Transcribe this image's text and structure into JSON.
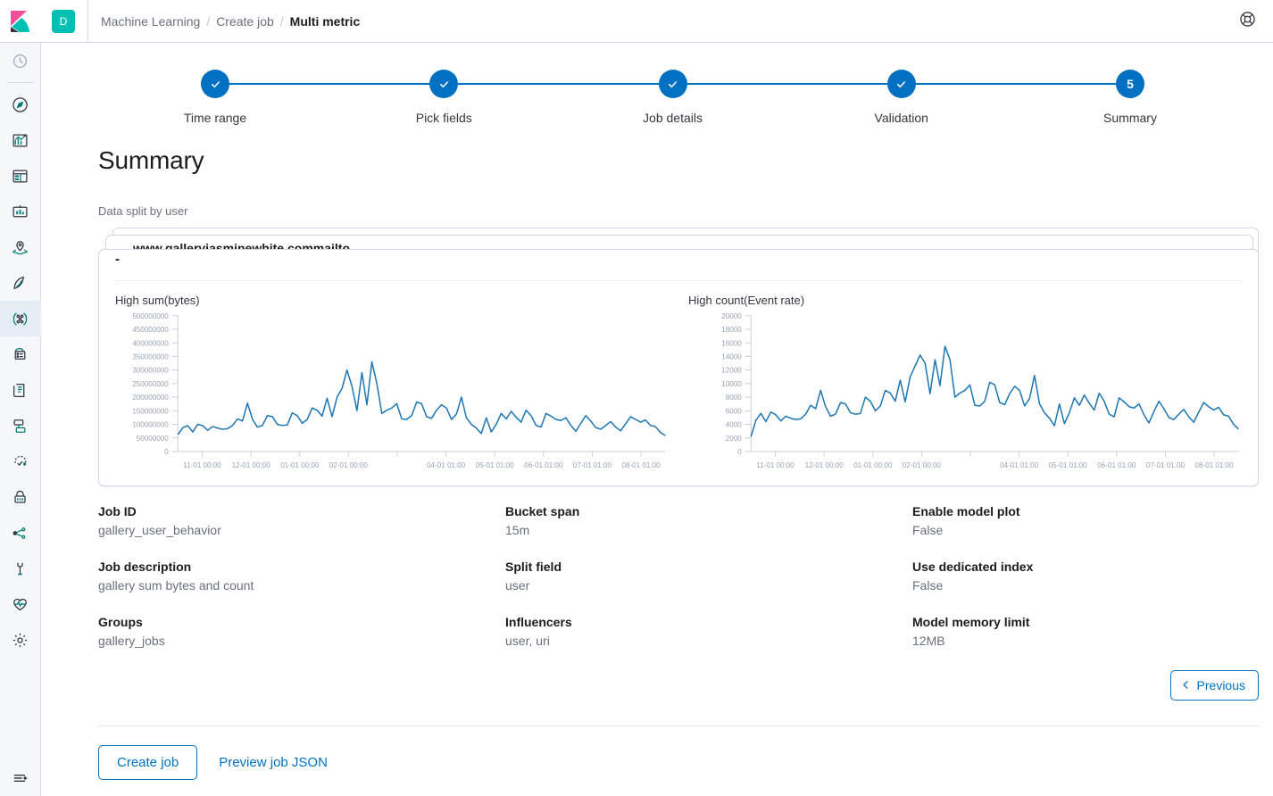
{
  "header": {
    "space_badge": "D",
    "breadcrumbs": [
      {
        "label": "Machine Learning",
        "current": false
      },
      {
        "label": "Create job",
        "current": false
      },
      {
        "label": "Multi metric",
        "current": true
      }
    ],
    "separator": "/",
    "help_icon": "help-lifebuoy-icon"
  },
  "sidebar": {
    "logo": "elastic-kibana-logo",
    "items": [
      {
        "icon": "recently-viewed-clock-icon",
        "selected": false
      },
      {
        "icon": "discover-compass-icon",
        "selected": false
      },
      {
        "icon": "visualize-chart-icon",
        "selected": false
      },
      {
        "icon": "dashboard-icon",
        "selected": false
      },
      {
        "icon": "canvas-icon",
        "selected": false
      },
      {
        "icon": "maps-icon",
        "selected": false
      },
      {
        "icon": "uptime-icon",
        "selected": false
      },
      {
        "icon": "machine-learning-icon",
        "selected": true
      },
      {
        "icon": "infrastructure-icon",
        "selected": false
      },
      {
        "icon": "logs-icon",
        "selected": false
      },
      {
        "icon": "apm-icon",
        "selected": false
      },
      {
        "icon": "siem-icon",
        "selected": false
      },
      {
        "icon": "security-lock-icon",
        "selected": false
      },
      {
        "icon": "graph-icon",
        "selected": false
      },
      {
        "icon": "dev-tools-wrench-icon",
        "selected": false
      },
      {
        "icon": "monitoring-heart-icon",
        "selected": false
      },
      {
        "icon": "management-gear-icon",
        "selected": false
      }
    ],
    "collapse_icon": "collapse-arrow-icon"
  },
  "steps": [
    {
      "num": "1",
      "label": "Time range",
      "complete": true
    },
    {
      "num": "2",
      "label": "Pick fields",
      "complete": true
    },
    {
      "num": "3",
      "label": "Job details",
      "complete": true
    },
    {
      "num": "4",
      "label": "Validation",
      "complete": true
    },
    {
      "num": "5",
      "label": "Summary",
      "complete": false
    }
  ],
  "page": {
    "title": "Summary",
    "split_label": "Data split by user"
  },
  "detector_cards": {
    "back_card_label": "....",
    "middle_card_label": "www.gallerviasminewhite.commailto",
    "front_card_label": "-"
  },
  "chart_data": [
    {
      "type": "line",
      "title": "High sum(bytes)",
      "xlabel": "",
      "ylabel": "",
      "ylim": [
        0,
        500000000
      ],
      "yticks": [
        0,
        50000000,
        100000000,
        150000000,
        200000000,
        250000000,
        300000000,
        350000000,
        400000000,
        450000000,
        500000000
      ],
      "ytick_labels": [
        "0",
        "50000000",
        "100000000",
        "150000000",
        "200000000",
        "250000000",
        "300000000",
        "350000000",
        "400000000",
        "450000000",
        "500000000"
      ],
      "xtick_labels": [
        "11-01 00:00",
        "12-01 00:00",
        "01-01 00:00",
        "02-01 00:00",
        "",
        "04-01 01:00",
        "05-01 01:00",
        "06-01 01:00",
        "07-01 01:00",
        "08-01 01:00"
      ],
      "grid": false,
      "legend": "none",
      "line_color": "#1f77b4",
      "values": [
        62,
        88,
        95,
        72,
        100,
        95,
        78,
        92,
        86,
        82,
        84,
        96,
        120,
        112,
        178,
        118,
        90,
        96,
        132,
        128,
        100,
        96,
        98,
        142,
        132,
        104,
        118,
        160,
        152,
        130,
        196,
        128,
        200,
        232,
        300,
        240,
        150,
        290,
        172,
        330,
        250,
        140,
        152,
        160,
        176,
        120,
        118,
        132,
        182,
        176,
        128,
        122,
        152,
        172,
        160,
        118,
        138,
        200,
        124,
        100,
        86,
        66,
        124,
        72,
        100,
        140,
        120,
        148,
        126,
        108,
        152,
        132,
        96,
        90,
        140,
        130,
        118,
        114,
        124,
        96,
        74,
        104,
        132,
        112,
        88,
        82,
        96,
        110,
        90,
        76,
        102,
        128,
        118,
        108,
        116,
        96,
        92,
        70,
        58
      ]
    },
    {
      "type": "line",
      "title": "High count(Event rate)",
      "xlabel": "",
      "ylabel": "",
      "ylim": [
        0,
        20000
      ],
      "yticks": [
        0,
        2000,
        4000,
        6000,
        8000,
        10000,
        12000,
        14000,
        16000,
        18000,
        20000
      ],
      "ytick_labels": [
        "0",
        "2000",
        "4000",
        "6000",
        "8000",
        "10000",
        "12000",
        "14000",
        "16000",
        "18000",
        "20000"
      ],
      "xtick_labels": [
        "11-01 00:00",
        "12-01 00:00",
        "01-01 00:00",
        "02-01 00:00",
        "",
        "04-01 01:00",
        "05-01 01:00",
        "06-01 01:00",
        "07-01 01:00",
        "08-01 01:00"
      ],
      "grid": false,
      "legend": "none",
      "line_color": "#1f77b4",
      "values": [
        2200,
        4600,
        5600,
        4400,
        5800,
        5400,
        4500,
        5200,
        4900,
        4700,
        4800,
        5500,
        6800,
        6300,
        9000,
        6600,
        5200,
        5500,
        7200,
        7000,
        5700,
        5500,
        5600,
        8000,
        7400,
        6000,
        6700,
        9000,
        8600,
        7400,
        10500,
        7300,
        11000,
        12600,
        14200,
        13000,
        8500,
        13500,
        9700,
        15500,
        13500,
        8000,
        8600,
        9000,
        9800,
        6800,
        6700,
        7400,
        10200,
        9800,
        7200,
        6900,
        8500,
        9600,
        9000,
        6700,
        7800,
        11200,
        7000,
        5700,
        4900,
        3800,
        7000,
        4100,
        5700,
        7900,
        6800,
        8300,
        7100,
        6100,
        8600,
        7400,
        5500,
        5100,
        7900,
        7300,
        6600,
        6400,
        7000,
        5400,
        4200,
        5900,
        7400,
        6300,
        5000,
        4700,
        5500,
        6200,
        5100,
        4300,
        5800,
        7200,
        6600,
        6100,
        6500,
        5400,
        5200,
        4000,
        3300
      ]
    }
  ],
  "details": [
    [
      {
        "key": "Job ID",
        "value": "gallery_user_behavior"
      },
      {
        "key": "Job description",
        "value": "gallery sum bytes and count"
      },
      {
        "key": "Groups",
        "value": "gallery_jobs"
      }
    ],
    [
      {
        "key": "Bucket span",
        "value": "15m"
      },
      {
        "key": "Split field",
        "value": "user"
      },
      {
        "key": "Influencers",
        "value": "user, uri"
      }
    ],
    [
      {
        "key": "Enable model plot",
        "value": "False"
      },
      {
        "key": "Use dedicated index",
        "value": "False"
      },
      {
        "key": "Model memory limit",
        "value": "12MB"
      }
    ]
  ],
  "buttons": {
    "previous": "Previous",
    "create_job": "Create job",
    "preview_json": "Preview job JSON"
  },
  "colors": {
    "accent_blue": "#0071c2",
    "chart_line": "#1f77b4",
    "space_badge": "#00bfb3",
    "text_dark": "#1a1c21",
    "text_muted": "#69707d"
  }
}
